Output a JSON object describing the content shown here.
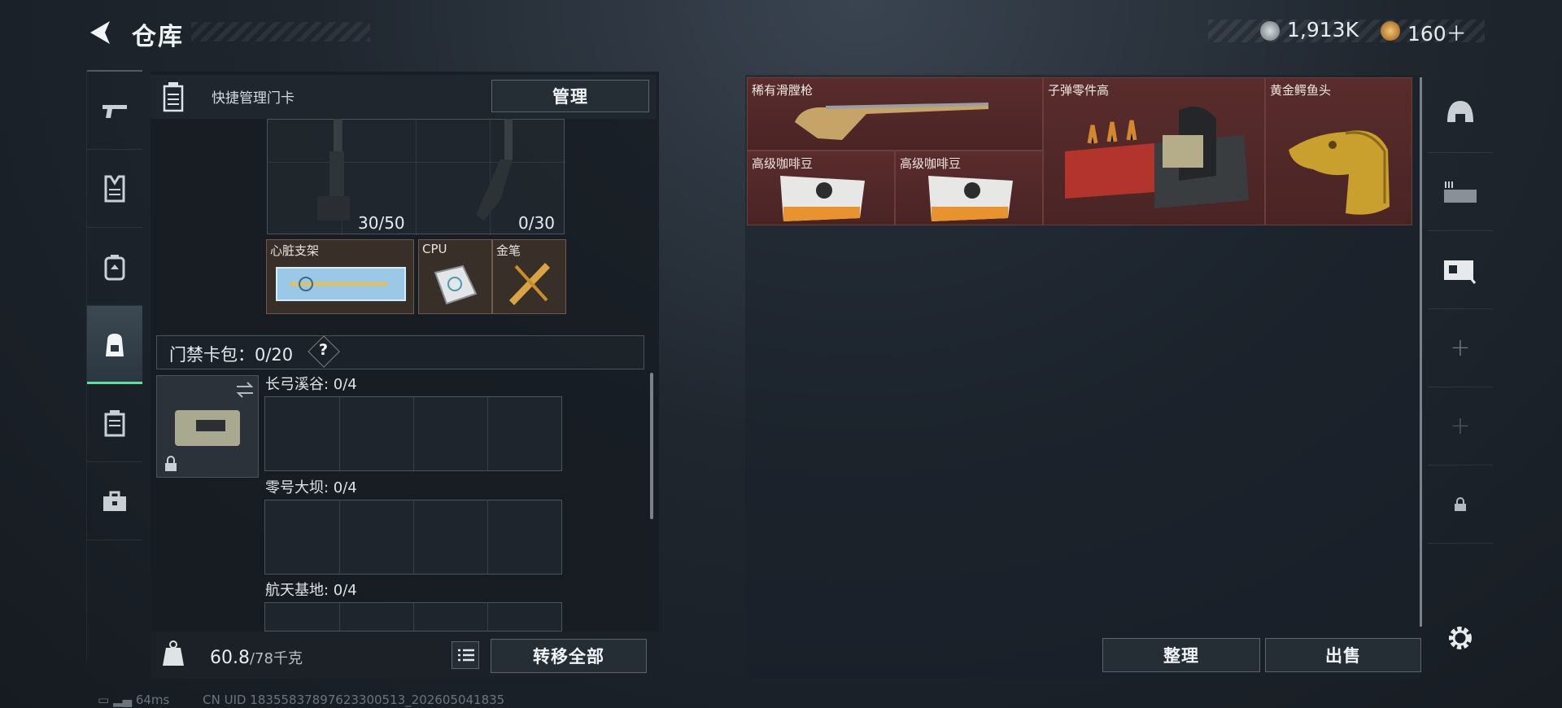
{
  "header": {
    "title": "仓库",
    "currency_silver": "1,913K",
    "currency_gold": "160＋"
  },
  "left_nav": {
    "items": [
      "weapon-icon",
      "armor-vest-icon",
      "backpack-icon",
      "safebox-icon",
      "card-holder-icon",
      "toolbox-icon"
    ],
    "active_index": 3
  },
  "quick_bar": {
    "label": "快捷管理门卡",
    "manage_button": "管理"
  },
  "magazines": [
    {
      "ammo": "30/50"
    },
    {
      "ammo": "0/30"
    }
  ],
  "items_left": [
    {
      "name": "心脏支架"
    },
    {
      "name": "CPU"
    },
    {
      "name": "金笔"
    }
  ],
  "card_pack": {
    "title": "门禁卡包：0/20",
    "help": "?"
  },
  "zones": [
    {
      "name": "长弓溪谷: 0/4"
    },
    {
      "name": "零号大坝: 0/4"
    },
    {
      "name": "航天基地: 0/4"
    }
  ],
  "bottom": {
    "weight_value": "60.8",
    "weight_capacity": "/78千克",
    "transfer_all": "转移全部"
  },
  "stash_items": [
    {
      "name": "稀有滑膛枪"
    },
    {
      "name": "子弹零件高"
    },
    {
      "name": "黄金鳄鱼头"
    },
    {
      "name": "高级咖啡豆"
    },
    {
      "name": "高级咖啡豆"
    }
  ],
  "right_actions": {
    "sort": "整理",
    "sell": "出售"
  },
  "right_nav": [
    "helmet-icon",
    "weapon-rack-icon",
    "stash-hand-icon",
    "add-slot-icon",
    "add-slot-icon",
    "lock-icon",
    "settings-icon"
  ],
  "footer": {
    "ping": "64ms",
    "uid": "CN UID 18355837897623300513_202605041835"
  },
  "colors": {
    "accent_green": "#58e2a8",
    "rare_red": "#5a2c2c",
    "item_brown": "#543e2e"
  }
}
